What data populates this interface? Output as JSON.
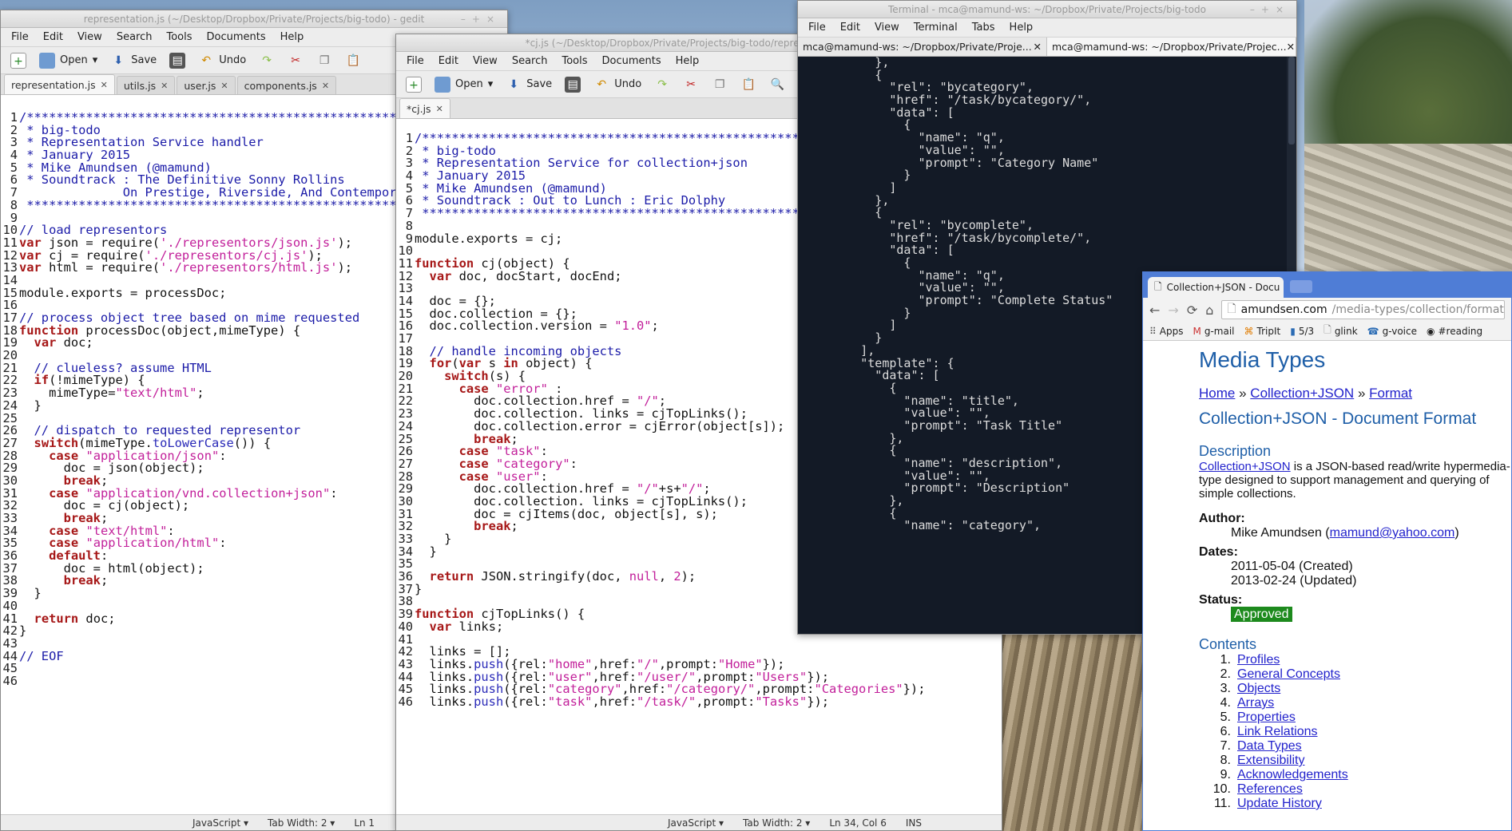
{
  "win1": {
    "title": "representation.js (~/Desktop/Dropbox/Private/Projects/big-todo) - gedit",
    "menu": [
      "File",
      "Edit",
      "View",
      "Search",
      "Tools",
      "Documents",
      "Help"
    ],
    "toolbar": {
      "open": "Open",
      "save": "Save",
      "undo": "Undo"
    },
    "tabs": [
      "representation.js",
      "utils.js",
      "user.js",
      "components.js"
    ],
    "status": {
      "lang": "JavaScript",
      "tab": "Tab Width: 2",
      "pos": "Ln 1"
    },
    "lines": [
      [
        [
          "c",
          "/************************************************************************************"
        ]
      ],
      [
        [
          "c",
          " * big-todo"
        ]
      ],
      [
        [
          "c",
          " * Representation Service handler"
        ]
      ],
      [
        [
          "c",
          " * January 2015"
        ]
      ],
      [
        [
          "c",
          " * Mike Amundsen (@mamund)"
        ]
      ],
      [
        [
          "c",
          " * Soundtrack : The Definitive Sonny Rollins"
        ]
      ],
      [
        [
          "c",
          "              On Prestige, Riverside, And Contemporary"
        ]
      ],
      [
        [
          "c",
          " ************************************************************************************/"
        ]
      ],
      [
        [
          "",
          ""
        ]
      ],
      [
        [
          "c",
          "// load representors"
        ]
      ],
      [
        [
          "k",
          "var"
        ],
        [
          "",
          " json = require("
        ],
        [
          "s",
          "'./representors/json.js'"
        ],
        [
          "",
          ");"
        ]
      ],
      [
        [
          "k",
          "var"
        ],
        [
          "",
          " cj = require("
        ],
        [
          "s",
          "'./representors/cj.js'"
        ],
        [
          "",
          ");"
        ]
      ],
      [
        [
          "k",
          "var"
        ],
        [
          "",
          " html = require("
        ],
        [
          "s",
          "'./representors/html.js'"
        ],
        [
          "",
          ");"
        ]
      ],
      [
        [
          "",
          ""
        ]
      ],
      [
        [
          "",
          "module.exports = processDoc;"
        ]
      ],
      [
        [
          "",
          ""
        ]
      ],
      [
        [
          "c",
          "// process object tree based on mime requested"
        ]
      ],
      [
        [
          "k",
          "function"
        ],
        [
          "",
          " processDoc(object,mimeType) {"
        ]
      ],
      [
        [
          "",
          "  "
        ],
        [
          "k",
          "var"
        ],
        [
          "",
          " doc;"
        ]
      ],
      [
        [
          "",
          ""
        ]
      ],
      [
        [
          "c",
          "  // clueless? assume HTML"
        ]
      ],
      [
        [
          "",
          "  "
        ],
        [
          "k",
          "if"
        ],
        [
          "",
          "(!mimeType) {"
        ]
      ],
      [
        [
          "",
          "    mimeType="
        ],
        [
          "s",
          "\"text/html\""
        ],
        [
          "",
          ";"
        ]
      ],
      [
        [
          "",
          "  }"
        ]
      ],
      [
        [
          "",
          ""
        ]
      ],
      [
        [
          "c",
          "  // dispatch to requested representor"
        ]
      ],
      [
        [
          "",
          "  "
        ],
        [
          "k",
          "switch"
        ],
        [
          "",
          "(mimeType."
        ],
        [
          "f",
          "toLowerCase"
        ],
        [
          "",
          "()) {"
        ]
      ],
      [
        [
          "",
          "    "
        ],
        [
          "k",
          "case"
        ],
        [
          "",
          " "
        ],
        [
          "s",
          "\"application/json\""
        ],
        [
          "",
          ":"
        ]
      ],
      [
        [
          "",
          "      doc = json(object);"
        ]
      ],
      [
        [
          "",
          "      "
        ],
        [
          "k",
          "break"
        ],
        [
          "",
          ";"
        ]
      ],
      [
        [
          "",
          "    "
        ],
        [
          "k",
          "case"
        ],
        [
          "",
          " "
        ],
        [
          "s",
          "\"application/vnd.collection+json\""
        ],
        [
          "",
          ":"
        ]
      ],
      [
        [
          "",
          "      doc = cj(object);"
        ]
      ],
      [
        [
          "",
          "      "
        ],
        [
          "k",
          "break"
        ],
        [
          "",
          ";"
        ]
      ],
      [
        [
          "",
          "    "
        ],
        [
          "k",
          "case"
        ],
        [
          "",
          " "
        ],
        [
          "s",
          "\"text/html\""
        ],
        [
          "",
          ":"
        ]
      ],
      [
        [
          "",
          "    "
        ],
        [
          "k",
          "case"
        ],
        [
          "",
          " "
        ],
        [
          "s",
          "\"application/html\""
        ],
        [
          "",
          ":"
        ]
      ],
      [
        [
          "",
          "    "
        ],
        [
          "k",
          "default"
        ],
        [
          "",
          ":"
        ]
      ],
      [
        [
          "",
          "      doc = html(object);"
        ]
      ],
      [
        [
          "",
          "      "
        ],
        [
          "k",
          "break"
        ],
        [
          "",
          ";"
        ]
      ],
      [
        [
          "",
          "  }"
        ]
      ],
      [
        [
          "",
          ""
        ]
      ],
      [
        [
          "",
          "  "
        ],
        [
          "k",
          "return"
        ],
        [
          "",
          " doc;"
        ]
      ],
      [
        [
          "",
          "}"
        ]
      ],
      [
        [
          "",
          ""
        ]
      ],
      [
        [
          "c",
          "// EOF"
        ]
      ],
      [
        [
          "",
          ""
        ]
      ],
      [
        [
          "",
          ""
        ]
      ]
    ]
  },
  "win2": {
    "title": "*cj.js (~/Desktop/Dropbox/Private/Projects/big-todo/representors) - gedit",
    "menu": [
      "File",
      "Edit",
      "View",
      "Search",
      "Tools",
      "Documents",
      "Help"
    ],
    "toolbar": {
      "open": "Open",
      "save": "Save",
      "undo": "Undo"
    },
    "tabs": [
      "*cj.js"
    ],
    "status": {
      "lang": "JavaScript",
      "tab": "Tab Width: 2",
      "pos": "Ln 34, Col 6",
      "mode": "INS"
    },
    "lines": [
      [
        [
          "c",
          "/************************************************************************************"
        ]
      ],
      [
        [
          "c",
          " * big-todo"
        ]
      ],
      [
        [
          "c",
          " * Representation Service for collection+json"
        ]
      ],
      [
        [
          "c",
          " * January 2015"
        ]
      ],
      [
        [
          "c",
          " * Mike Amundsen (@mamund)"
        ]
      ],
      [
        [
          "c",
          " * Soundtrack : Out to Lunch : Eric Dolphy"
        ]
      ],
      [
        [
          "c",
          " ************************************************************************************/"
        ]
      ],
      [
        [
          "",
          ""
        ]
      ],
      [
        [
          "",
          "module.exports = cj;"
        ]
      ],
      [
        [
          "",
          ""
        ]
      ],
      [
        [
          "k",
          "function"
        ],
        [
          "",
          " cj(object) {"
        ]
      ],
      [
        [
          "",
          "  "
        ],
        [
          "k",
          "var"
        ],
        [
          "",
          " doc, docStart, docEnd;"
        ]
      ],
      [
        [
          "",
          ""
        ]
      ],
      [
        [
          "",
          "  doc = {};"
        ]
      ],
      [
        [
          "",
          "  doc.collection = {};"
        ]
      ],
      [
        [
          "",
          "  doc.collection.version = "
        ],
        [
          "s",
          "\"1.0\""
        ],
        [
          "",
          ";"
        ]
      ],
      [
        [
          "",
          ""
        ]
      ],
      [
        [
          "c",
          "  // handle incoming objects"
        ]
      ],
      [
        [
          "",
          "  "
        ],
        [
          "k",
          "for"
        ],
        [
          "",
          "("
        ],
        [
          "k",
          "var"
        ],
        [
          "",
          " s "
        ],
        [
          "k",
          "in"
        ],
        [
          "",
          " object) {"
        ]
      ],
      [
        [
          "",
          "    "
        ],
        [
          "k",
          "switch"
        ],
        [
          "",
          "(s) {"
        ]
      ],
      [
        [
          "",
          "      "
        ],
        [
          "k",
          "case"
        ],
        [
          "",
          " "
        ],
        [
          "s",
          "\"error\""
        ],
        [
          "",
          " :"
        ]
      ],
      [
        [
          "",
          "        doc.collection.href = "
        ],
        [
          "s",
          "\"/\""
        ],
        [
          "",
          ";"
        ]
      ],
      [
        [
          "",
          "        doc.collection. links = cjTopLinks();"
        ]
      ],
      [
        [
          "",
          "        doc.collection.error = cjError(object[s]);"
        ]
      ],
      [
        [
          "",
          "        "
        ],
        [
          "k",
          "break"
        ],
        [
          "",
          ";"
        ]
      ],
      [
        [
          "",
          "      "
        ],
        [
          "k",
          "case"
        ],
        [
          "",
          " "
        ],
        [
          "s",
          "\"task\""
        ],
        [
          "",
          ":"
        ]
      ],
      [
        [
          "",
          "      "
        ],
        [
          "k",
          "case"
        ],
        [
          "",
          " "
        ],
        [
          "s",
          "\"category\""
        ],
        [
          "",
          ":"
        ]
      ],
      [
        [
          "",
          "      "
        ],
        [
          "k",
          "case"
        ],
        [
          "",
          " "
        ],
        [
          "s",
          "\"user\""
        ],
        [
          "",
          ":"
        ]
      ],
      [
        [
          "",
          "        doc.collection.href = "
        ],
        [
          "s",
          "\"/\""
        ],
        [
          "",
          "+s+"
        ],
        [
          "s",
          "\"/\""
        ],
        [
          "",
          ";"
        ]
      ],
      [
        [
          "",
          "        doc.collection. links = cjTopLinks();"
        ]
      ],
      [
        [
          "",
          "        doc = cjItems(doc, object[s], s);"
        ]
      ],
      [
        [
          "",
          "        "
        ],
        [
          "k",
          "break"
        ],
        [
          "",
          ";"
        ]
      ],
      [
        [
          "",
          "    }"
        ]
      ],
      [
        [
          "",
          "  }"
        ]
      ],
      [
        [
          "",
          ""
        ]
      ],
      [
        [
          "",
          "  "
        ],
        [
          "k",
          "return"
        ],
        [
          "",
          " JSON.stringify(doc, "
        ],
        [
          "s",
          "null"
        ],
        [
          "",
          ", "
        ],
        [
          "s",
          "2"
        ],
        [
          "",
          ");"
        ]
      ],
      [
        [
          "",
          "}"
        ]
      ],
      [
        [
          "",
          ""
        ]
      ],
      [
        [
          "k",
          "function"
        ],
        [
          "",
          " cjTopLinks() {"
        ]
      ],
      [
        [
          "",
          "  "
        ],
        [
          "k",
          "var"
        ],
        [
          "",
          " links;"
        ]
      ],
      [
        [
          "",
          ""
        ]
      ],
      [
        [
          "",
          "  links = [];"
        ]
      ],
      [
        [
          "",
          "  links."
        ],
        [
          "f",
          "push"
        ],
        [
          "",
          "({rel:"
        ],
        [
          "s",
          "\"home\""
        ],
        [
          "",
          ",href:"
        ],
        [
          "s",
          "\"/\""
        ],
        [
          "",
          ",prompt:"
        ],
        [
          "s",
          "\"Home\""
        ],
        [
          "",
          "});"
        ]
      ],
      [
        [
          "",
          "  links."
        ],
        [
          "f",
          "push"
        ],
        [
          "",
          "({rel:"
        ],
        [
          "s",
          "\"user\""
        ],
        [
          "",
          ",href:"
        ],
        [
          "s",
          "\"/user/\""
        ],
        [
          "",
          ",prompt:"
        ],
        [
          "s",
          "\"Users\""
        ],
        [
          "",
          "});"
        ]
      ],
      [
        [
          "",
          "  links."
        ],
        [
          "f",
          "push"
        ],
        [
          "",
          "({rel:"
        ],
        [
          "s",
          "\"category\""
        ],
        [
          "",
          ",href:"
        ],
        [
          "s",
          "\"/category/\""
        ],
        [
          "",
          ",prompt:"
        ],
        [
          "s",
          "\"Categories\""
        ],
        [
          "",
          "});"
        ]
      ],
      [
        [
          "",
          "  links."
        ],
        [
          "f",
          "push"
        ],
        [
          "",
          "({rel:"
        ],
        [
          "s",
          "\"task\""
        ],
        [
          "",
          ",href:"
        ],
        [
          "s",
          "\"/task/\""
        ],
        [
          "",
          ",prompt:"
        ],
        [
          "s",
          "\"Tasks\""
        ],
        [
          "",
          "});"
        ]
      ]
    ]
  },
  "terminal": {
    "title": "Terminal - mca@mamund-ws: ~/Dropbox/Private/Projects/big-todo",
    "menu": [
      "File",
      "Edit",
      "View",
      "Terminal",
      "Tabs",
      "Help"
    ],
    "tabs": [
      "mca@mamund-ws: ~/Dropbox/Private/Proje...",
      "mca@mamund-ws: ~/Dropbox/Private/Projec..."
    ],
    "lines": [
      "          },",
      "          {",
      "            \"rel\": \"bycategory\",",
      "            \"href\": \"/task/bycategory/\",",
      "            \"data\": [",
      "              {",
      "                \"name\": \"q\",",
      "                \"value\": \"\",",
      "                \"prompt\": \"Category Name\"",
      "              }",
      "            ]",
      "          },",
      "          {",
      "            \"rel\": \"bycomplete\",",
      "            \"href\": \"/task/bycomplete/\",",
      "            \"data\": [",
      "              {",
      "                \"name\": \"q\",",
      "                \"value\": \"\",",
      "                \"prompt\": \"Complete Status\"",
      "              }",
      "            ]",
      "          }",
      "        ],",
      "        \"template\": {",
      "          \"data\": [",
      "            {",
      "              \"name\": \"title\",",
      "              \"value\": \"\",",
      "              \"prompt\": \"Task Title\"",
      "            },",
      "            {",
      "              \"name\": \"description\",",
      "              \"value\": \"\",",
      "              \"prompt\": \"Description\"",
      "            },",
      "            {",
      "              \"name\": \"category\","
    ]
  },
  "browser": {
    "tab": "Collection+JSON - Docu",
    "url_host": "amundsen.com",
    "url_path": "/media-types/collection/format/",
    "bookmarks": [
      "Apps",
      "g-mail",
      "TripIt",
      "5/3",
      "glink",
      "g-voice",
      "#reading"
    ],
    "site_title": "Media Types",
    "crumbs": [
      "Home",
      "Collection+JSON",
      "Format"
    ],
    "crumb_sep": "»",
    "doc_title": "Collection+JSON - Document Format",
    "desc_heading": "Description",
    "desc_link": "Collection+JSON",
    "desc_text": " is a JSON-based read/write hypermedia-type designed to support management and querying of simple collections.",
    "author_label": "Author:",
    "author_name": "Mike Amundsen (",
    "author_email": "mamund@yahoo.com",
    "author_close": ")",
    "dates_label": "Dates:",
    "date_created": "2011-05-04 (Created)",
    "date_updated": "2013-02-24 (Updated)",
    "status_label": "Status:",
    "status_value": "Approved",
    "contents_heading": "Contents",
    "contents": [
      "Profiles",
      "General Concepts",
      "Objects",
      "Arrays",
      "Properties",
      "Link Relations",
      "Data Types",
      "Extensibility",
      "Acknowledgements",
      "References",
      "Update History"
    ]
  },
  "colors": {
    "keyword": "#a61717",
    "string": "#c21f9a",
    "comment": "#1b1ba8",
    "terminal_bg": "#131a26",
    "link": "#2222cc",
    "heading": "#1f5fa8",
    "approved": "#1d8a1d"
  }
}
